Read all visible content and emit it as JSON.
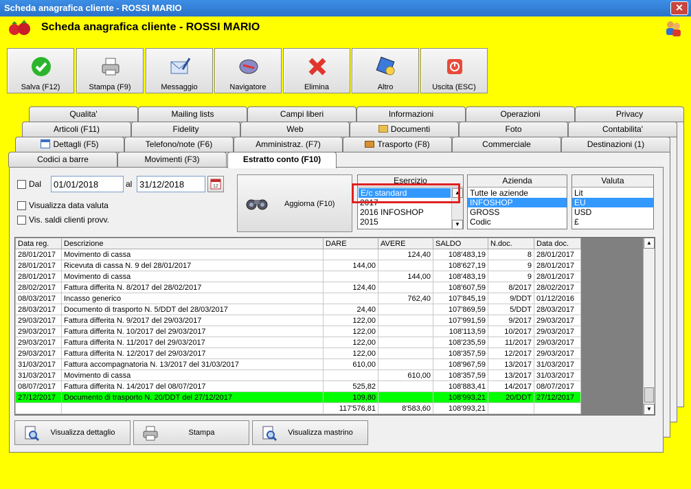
{
  "window": {
    "title": "Scheda anagrafica cliente - ROSSI MARIO",
    "close": "✕"
  },
  "header": {
    "title": "Scheda anagrafica cliente - ROSSI MARIO"
  },
  "toolbar": [
    {
      "label": "Salva (F12)",
      "icon": "check-icon"
    },
    {
      "label": "Stampa (F9)",
      "icon": "printer-icon"
    },
    {
      "label": "Messaggio",
      "icon": "mail-icon"
    },
    {
      "label": "Navigatore",
      "icon": "compass-icon"
    },
    {
      "label": "Elimina",
      "icon": "delete-icon"
    },
    {
      "label": "Altro",
      "icon": "altro-icon"
    },
    {
      "label": "Uscita (ESC)",
      "icon": "exit-icon"
    }
  ],
  "tabs": {
    "row1": [
      "Qualita'",
      "Mailing lists",
      "Campi liberi",
      "Informazioni",
      "Operazioni",
      "Privacy"
    ],
    "row2": [
      "Articoli (F11)",
      "Fidelity",
      "Web",
      "Documenti",
      "Foto",
      "Contabilita'"
    ],
    "row3": [
      "Dettagli (F5)",
      "Telefono/note (F6)",
      "Amministraz. (F7)",
      "Trasporto (F8)",
      "Commerciale",
      "Destinazioni (1)"
    ],
    "row4": [
      "Codici a barre",
      "Movimenti (F3)",
      "Estratto conto (F10)"
    ]
  },
  "filters": {
    "dal_label": "Dal",
    "date_from": "01/01/2018",
    "al_label": "al",
    "date_to": "31/12/2018",
    "vis_data_valuta": "Visualizza data valuta",
    "vis_saldi": "Vis. saldi clienti provv.",
    "aggiorna": "Aggiorna (F10)"
  },
  "esercizio": {
    "title": "Esercizio",
    "items": [
      "E/c standard",
      "2017",
      "2016 INFOSHOP",
      "2015"
    ]
  },
  "azienda": {
    "title": "Azienda",
    "items": [
      "Tutte le aziende",
      "INFOSHOP",
      "GROSS",
      "Codic"
    ]
  },
  "valuta": {
    "title": "Valuta",
    "items": [
      "Lit",
      "EU",
      "USD",
      "£"
    ]
  },
  "table": {
    "columns": [
      "Data reg.",
      "Descrizione",
      "DARE",
      "AVERE",
      "SALDO",
      "N.doc.",
      "Data doc."
    ],
    "rows": [
      [
        "28/01/2017",
        "Movimento di cassa",
        "",
        "124,40",
        "108'483,19",
        "8",
        "28/01/2017"
      ],
      [
        "28/01/2017",
        "Ricevuta di cassa N. 9 del 28/01/2017",
        "144,00",
        "",
        "108'627,19",
        "9",
        "28/01/2017"
      ],
      [
        "28/01/2017",
        "Movimento di cassa",
        "",
        "144,00",
        "108'483,19",
        "9",
        "28/01/2017"
      ],
      [
        "28/02/2017",
        "Fattura differita N. 8/2017 del 28/02/2017",
        "124,40",
        "",
        "108'607,59",
        "8/2017",
        "28/02/2017"
      ],
      [
        "08/03/2017",
        "Incasso generico",
        "",
        "762,40",
        "107'845,19",
        "9/DDT",
        "01/12/2016"
      ],
      [
        "28/03/2017",
        "Documento di trasporto N. 5/DDT del 28/03/2017",
        "24,40",
        "",
        "107'869,59",
        "5/DDT",
        "28/03/2017"
      ],
      [
        "29/03/2017",
        "Fattura differita N. 9/2017 del 29/03/2017",
        "122,00",
        "",
        "107'991,59",
        "9/2017",
        "29/03/2017"
      ],
      [
        "29/03/2017",
        "Fattura differita N. 10/2017 del 29/03/2017",
        "122,00",
        "",
        "108'113,59",
        "10/2017",
        "29/03/2017"
      ],
      [
        "29/03/2017",
        "Fattura differita N. 11/2017 del 29/03/2017",
        "122,00",
        "",
        "108'235,59",
        "11/2017",
        "29/03/2017"
      ],
      [
        "29/03/2017",
        "Fattura differita N. 12/2017 del 29/03/2017",
        "122,00",
        "",
        "108'357,59",
        "12/2017",
        "29/03/2017"
      ],
      [
        "31/03/2017",
        "Fattura accompagnatoria N. 13/2017 del 31/03/2017",
        "610,00",
        "",
        "108'967,59",
        "13/2017",
        "31/03/2017"
      ],
      [
        "31/03/2017",
        "Movimento di cassa",
        "",
        "610,00",
        "108'357,59",
        "13/2017",
        "31/03/2017"
      ],
      [
        "08/07/2017",
        "Fattura differita N. 14/2017 del 08/07/2017",
        "525,82",
        "",
        "108'883,41",
        "14/2017",
        "08/07/2017"
      ],
      [
        "27/12/2017",
        "Documento di trasporto N. 20/DDT del 27/12/2017",
        "109,80",
        "",
        "108'993,21",
        "20/DDT",
        "27/12/2017"
      ],
      [
        "",
        "",
        "117'576,81",
        "8'583,60",
        "108'993,21",
        "",
        ""
      ]
    ]
  },
  "bottom": {
    "dettaglio": "Visualizza dettaglio",
    "stampa": "Stampa",
    "mastrino": "Visualizza mastrino"
  }
}
